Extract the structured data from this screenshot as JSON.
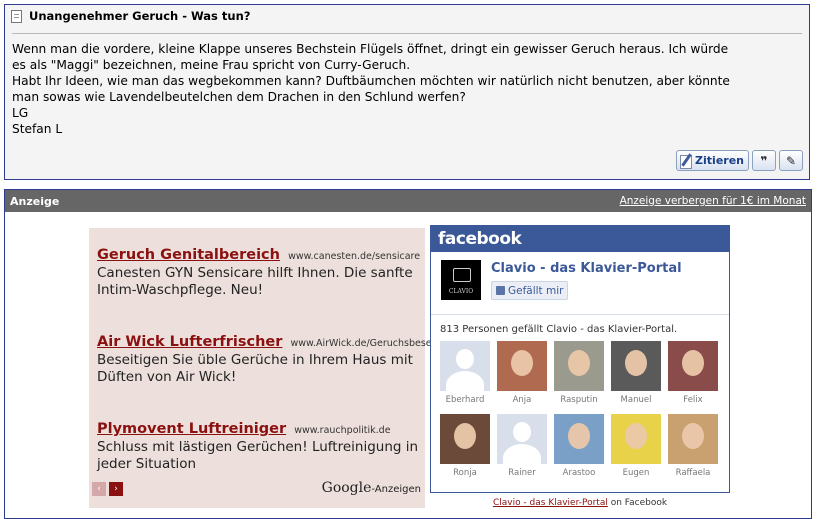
{
  "post": {
    "title": "Unangenehmer Geruch - Was tun?",
    "lines": [
      "Wenn man die vordere, kleine Klappe unseres Bechstein Flügels öffnet, dringt ein gewisser Geruch heraus. Ich würde",
      "es als \"Maggi\" bezeichnen, meine Frau spricht von Curry-Geruch.",
      "Habt Ihr Ideen, wie man das wegbekommen kann? Duftbäumchen möchten wir natürlich nicht benutzen, aber könnte",
      "man sowas wie Lavendelbeutelchen dem Drachen in den Schlund werfen?",
      "LG",
      "Stefan L"
    ],
    "quote_button": "Zitieren",
    "icons": [
      "document-icon",
      "pen-icon",
      "multi-quote-icon",
      "edit-icon"
    ]
  },
  "ad_section": {
    "title": "Anzeige",
    "hide_link": "Anzeige verbergen für  1€ im Monat"
  },
  "google_ads": {
    "items": [
      {
        "title": "Geruch Genitalbereich",
        "url": "www.canesten.de/sensicare",
        "text": "Canesten GYN Sensicare hilft Ihnen. Die sanfte Intim-Waschpflege. Neu!"
      },
      {
        "title": "Air Wick Lufterfrischer",
        "url": "www.AirWick.de/Geruchsbeseitigu",
        "text": "Beseitigen Sie üble Gerüche in Ihrem Haus mit Düften von Air Wick!"
      },
      {
        "title": "Plymovent Luftreiniger",
        "url": "www.rauchpolitik.de",
        "text": "Schluss mit lästigen Gerüchen! Luftreinigung in jeder Situation"
      }
    ],
    "prev": "‹",
    "next": "›",
    "brand": "Google",
    "brand_suffix": "-Anzeigen",
    "colors": {
      "title": "#8b1010",
      "background": "#ede0dc"
    }
  },
  "facebook": {
    "header": "facebook",
    "page_name": "Clavio - das Klavier-Portal",
    "logo_text": "CLAVIO",
    "like_button": "Gefällt mir",
    "count_text": "813 Personen gefällt Clavio - das Klavier-Portal.",
    "fans": [
      {
        "name": "Eberhard",
        "photo": false,
        "color": "#d8dfea"
      },
      {
        "name": "Anja",
        "photo": true,
        "color": "#b06a50"
      },
      {
        "name": "Rasputin",
        "photo": true,
        "color": "#9a9a8e"
      },
      {
        "name": "Manuel",
        "photo": true,
        "color": "#5a5a5a"
      },
      {
        "name": "Felix",
        "photo": true,
        "color": "#8a4b4b"
      },
      {
        "name": "Ronja",
        "photo": true,
        "color": "#6b4a3a"
      },
      {
        "name": "Rainer",
        "photo": false,
        "color": "#d8dfea"
      },
      {
        "name": "Arastoo",
        "photo": true,
        "color": "#7aa0c8"
      },
      {
        "name": "Eugen",
        "photo": true,
        "color": "#e8d24a"
      },
      {
        "name": "Raffaela",
        "photo": true,
        "color": "#c9a070"
      }
    ],
    "footer_link": "Clavio - das Klavier-Portal",
    "footer_suffix": " on Facebook",
    "colors": {
      "brand": "#3b5998"
    }
  }
}
